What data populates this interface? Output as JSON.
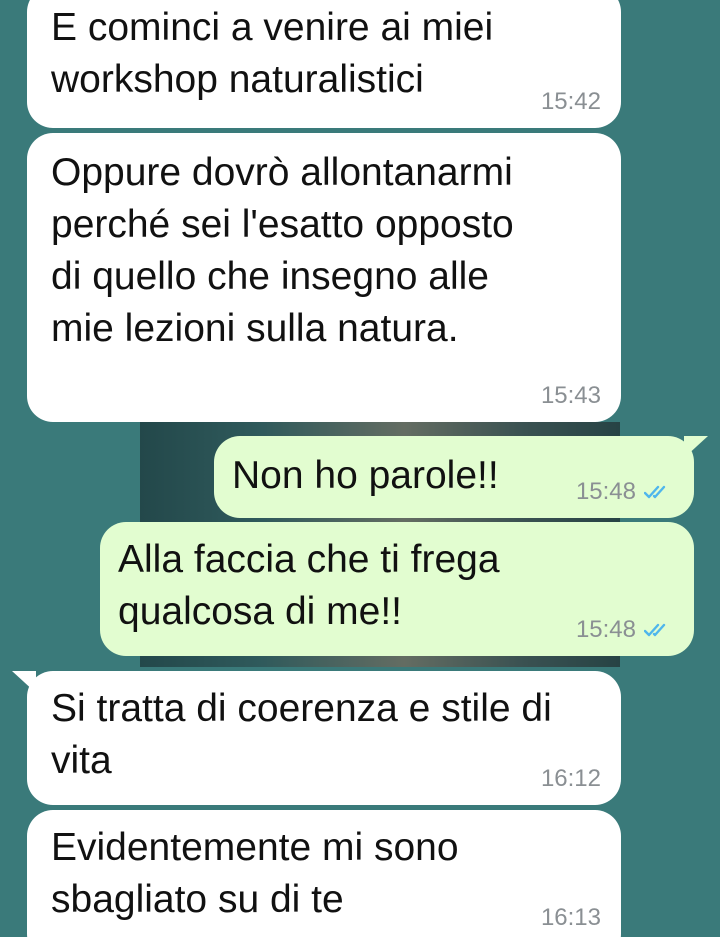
{
  "messages": [
    {
      "direction": "in",
      "text": "E cominci a venire ai miei\nworkshop naturalistici",
      "time": "15:42"
    },
    {
      "direction": "in",
      "text": "Oppure dovrò allontanarmi\nperché sei l'esatto opposto\ndi quello che insegno alle\nmie lezioni sulla natura.",
      "time": "15:43"
    },
    {
      "direction": "out",
      "text": "Non ho parole!!",
      "time": "15:48",
      "status": "read"
    },
    {
      "direction": "out",
      "text": "Alla faccia che ti frega\nqualcosa di me!!",
      "time": "15:48",
      "status": "read"
    },
    {
      "direction": "in",
      "text": "Si tratta di coerenza e stile di\nvita",
      "time": "16:12"
    },
    {
      "direction": "in",
      "text": "Evidentemente mi sono\nsbagliato su di te",
      "time": "16:13"
    }
  ],
  "colors": {
    "background": "#3a7a7a",
    "incoming_bubble": "#ffffff",
    "outgoing_bubble": "#e2fdd0",
    "read_ticks": "#4fb6ec",
    "timestamp": "#8a8f93"
  }
}
